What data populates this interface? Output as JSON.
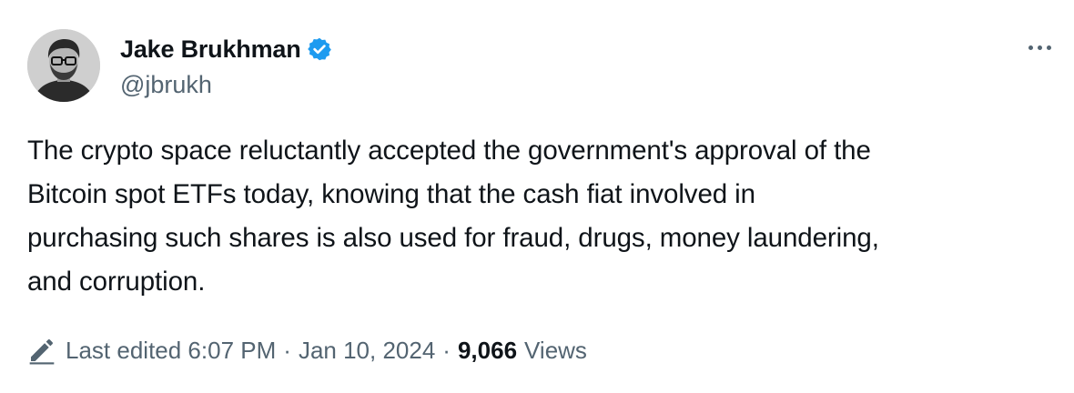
{
  "author": {
    "display_name": "Jake Brukhman",
    "handle": "@jbrukh",
    "verified": true,
    "avatar_icon": "user-avatar"
  },
  "menu": {
    "icon": "more-options-icon"
  },
  "tweet": {
    "lines": [
      "The crypto space reluctantly accepted the government's approval of the",
      "Bitcoin spot ETFs today, knowing that the cash fiat involved in",
      "purchasing such shares is also used for fraud, drugs, money laundering,",
      "and corruption."
    ]
  },
  "meta": {
    "edited_label": "Last edited 6:07 PM",
    "separator": "·",
    "date": "Jan 10, 2024",
    "views_count": "9,066",
    "views_label": "Views",
    "edit_icon": "pencil-icon"
  },
  "colors": {
    "text_primary": "#0f1419",
    "text_secondary": "#536471",
    "verified_blue": "#1d9bf0"
  }
}
